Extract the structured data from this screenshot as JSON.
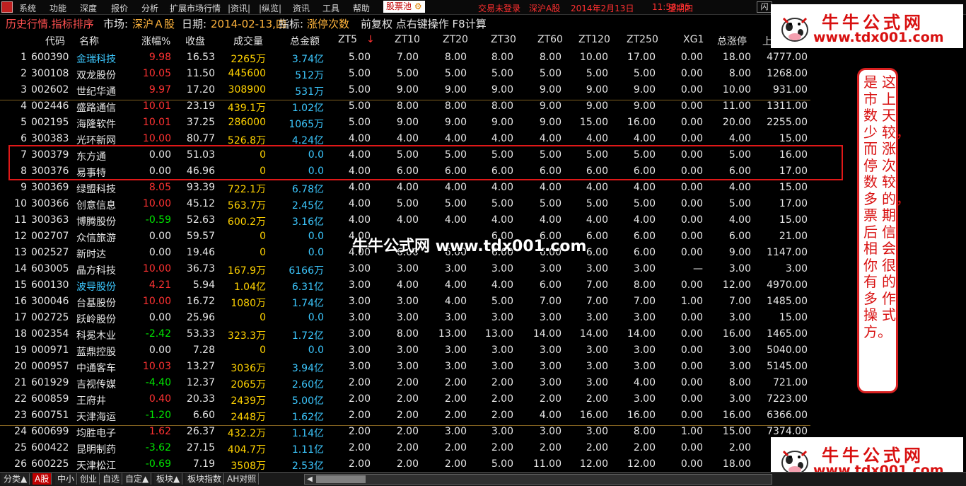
{
  "menu": {
    "items": [
      "系统",
      "功能",
      "深度",
      "报价",
      "分析",
      "扩展市场行情",
      "|资讯|",
      "|纵览|",
      "资讯",
      "工具",
      "帮助"
    ],
    "pool_label": "股票池",
    "status": [
      "交易未登录",
      "深沪A股",
      "2014年2月13日",
      "11:58:35",
      "星期四"
    ],
    "right_box": "闪"
  },
  "title": {
    "name": "历史行情.指标排序",
    "market_label": "市场:",
    "market": "深沪Ａ股",
    "date_label": "日期:",
    "date": "2014-02-13,四",
    "indicator_label": "指标:",
    "indicator": "涨停次数",
    "extra": "前复权 点右键操作 F8计算"
  },
  "columns": [
    "代码",
    "名称",
    "涨幅%",
    "收盘",
    "成交量",
    "总金额",
    "ZT5",
    "ZT10",
    "ZT20",
    "ZT30",
    "ZT60",
    "ZT120",
    "ZT250",
    "XG1",
    "总涨停",
    "上"
  ],
  "sort_arrow": "↓",
  "rows": [
    {
      "n": "1",
      "code": "600390",
      "name": "金瑞科技",
      "chg": "9.98",
      "close": "16.53",
      "vol": "2265",
      "vunit": "万",
      "amt": "3.74",
      "aunit": "亿",
      "zt": [
        "5.00",
        "7.00",
        "8.00",
        "8.00",
        "8.00",
        "10.00",
        "17.00"
      ],
      "xg1": "0.00",
      "total": "18.00",
      "last": "4777.00",
      "chgc": "red",
      "namec": "cyan"
    },
    {
      "n": "2",
      "code": "300108",
      "name": "双龙股份",
      "chg": "10.05",
      "close": "11.50",
      "vol": "445600",
      "vunit": "",
      "amt": "512",
      "aunit": "万",
      "zt": [
        "5.00",
        "5.00",
        "5.00",
        "5.00",
        "5.00",
        "5.00",
        "5.00"
      ],
      "xg1": "0.00",
      "total": "8.00",
      "last": "1268.00",
      "chgc": "red",
      "namec": "white"
    },
    {
      "n": "3",
      "code": "002602",
      "name": "世纪华通",
      "chg": "9.97",
      "close": "17.20",
      "vol": "308900",
      "vunit": "",
      "amt": "531",
      "aunit": "万",
      "zt": [
        "5.00",
        "9.00",
        "9.00",
        "9.00",
        "9.00",
        "9.00",
        "9.00"
      ],
      "xg1": "0.00",
      "total": "10.00",
      "last": "931.00",
      "chgc": "red",
      "namec": "white"
    },
    {
      "n": "4",
      "code": "002446",
      "name": "盛路通信",
      "chg": "10.01",
      "close": "23.19",
      "vol": "439.1",
      "vunit": "万",
      "amt": "1.02",
      "aunit": "亿",
      "zt": [
        "5.00",
        "8.00",
        "8.00",
        "8.00",
        "9.00",
        "9.00",
        "9.00"
      ],
      "xg1": "0.00",
      "total": "11.00",
      "last": "1311.00",
      "chgc": "red",
      "namec": "white"
    },
    {
      "n": "5",
      "code": "002195",
      "name": "海隆软件",
      "chg": "10.01",
      "close": "37.25",
      "vol": "286000",
      "vunit": "",
      "amt": "1065",
      "aunit": "万",
      "zt": [
        "5.00",
        "9.00",
        "9.00",
        "9.00",
        "9.00",
        "15.00",
        "16.00"
      ],
      "xg1": "0.00",
      "total": "20.00",
      "last": "2255.00",
      "chgc": "red",
      "namec": "white"
    },
    {
      "n": "6",
      "code": "300383",
      "name": "光环新网",
      "chg": "10.00",
      "close": "80.77",
      "vol": "526.8",
      "vunit": "万",
      "amt": "4.24",
      "aunit": "亿",
      "zt": [
        "4.00",
        "4.00",
        "4.00",
        "4.00",
        "4.00",
        "4.00",
        "4.00"
      ],
      "xg1": "0.00",
      "total": "4.00",
      "last": "15.00",
      "chgc": "red",
      "namec": "white"
    },
    {
      "n": "7",
      "code": "300379",
      "name": "东方通",
      "chg": "0.00",
      "close": "51.03",
      "vol": "0",
      "vunit": "",
      "amt": "0.0",
      "aunit": "",
      "zt": [
        "4.00",
        "5.00",
        "5.00",
        "5.00",
        "5.00",
        "5.00",
        "5.00"
      ],
      "xg1": "0.00",
      "total": "5.00",
      "last": "16.00",
      "chgc": "white",
      "namec": "white"
    },
    {
      "n": "8",
      "code": "300376",
      "name": "易事特",
      "chg": "0.00",
      "close": "46.96",
      "vol": "0",
      "vunit": "",
      "amt": "0.0",
      "aunit": "",
      "zt": [
        "4.00",
        "6.00",
        "6.00",
        "6.00",
        "6.00",
        "6.00",
        "6.00"
      ],
      "xg1": "0.00",
      "total": "6.00",
      "last": "17.00",
      "chgc": "white",
      "namec": "white"
    },
    {
      "n": "9",
      "code": "300369",
      "name": "绿盟科技",
      "chg": "8.05",
      "close": "93.39",
      "vol": "722.1",
      "vunit": "万",
      "amt": "6.78",
      "aunit": "亿",
      "zt": [
        "4.00",
        "4.00",
        "4.00",
        "4.00",
        "4.00",
        "4.00",
        "4.00"
      ],
      "xg1": "0.00",
      "total": "4.00",
      "last": "15.00",
      "chgc": "red",
      "namec": "white"
    },
    {
      "n": "10",
      "code": "300366",
      "name": "创意信息",
      "chg": "10.00",
      "close": "45.12",
      "vol": "563.7",
      "vunit": "万",
      "amt": "2.45",
      "aunit": "亿",
      "zt": [
        "4.00",
        "5.00",
        "5.00",
        "5.00",
        "5.00",
        "5.00",
        "5.00"
      ],
      "xg1": "0.00",
      "total": "5.00",
      "last": "17.00",
      "chgc": "red",
      "namec": "white"
    },
    {
      "n": "11",
      "code": "300363",
      "name": "博腾股份",
      "chg": "-0.59",
      "close": "52.63",
      "vol": "600.2",
      "vunit": "万",
      "amt": "3.16",
      "aunit": "亿",
      "zt": [
        "4.00",
        "4.00",
        "4.00",
        "4.00",
        "4.00",
        "4.00",
        "4.00"
      ],
      "xg1": "0.00",
      "total": "4.00",
      "last": "15.00",
      "chgc": "green",
      "namec": "white"
    },
    {
      "n": "12",
      "code": "002707",
      "name": "众信旅游",
      "chg": "0.00",
      "close": "59.57",
      "vol": "0",
      "vunit": "",
      "amt": "0.0",
      "aunit": "",
      "zt": [
        "4.00",
        "",
        "",
        "6.00",
        "6.00",
        "6.00",
        "6.00"
      ],
      "xg1": "0.00",
      "total": "6.00",
      "last": "21.00",
      "chgc": "white",
      "namec": "white"
    },
    {
      "n": "13",
      "code": "002527",
      "name": "新时达",
      "chg": "0.00",
      "close": "19.46",
      "vol": "0",
      "vunit": "",
      "amt": "0.0",
      "aunit": "",
      "zt": [
        "4.00",
        "6.00",
        "6.00",
        "6.00",
        "6.00",
        "6.00",
        "6.00"
      ],
      "xg1": "0.00",
      "total": "9.00",
      "last": "1147.00",
      "chgc": "white",
      "namec": "white"
    },
    {
      "n": "14",
      "code": "603005",
      "name": "晶方科技",
      "chg": "10.00",
      "close": "36.73",
      "vol": "167.9",
      "vunit": "万",
      "amt": "6166",
      "aunit": "万",
      "zt": [
        "3.00",
        "3.00",
        "3.00",
        "3.00",
        "3.00",
        "3.00",
        "3.00"
      ],
      "xg1": "—",
      "total": "3.00",
      "last": "3.00",
      "chgc": "red",
      "namec": "white"
    },
    {
      "n": "15",
      "code": "600130",
      "name": "波导股份",
      "chg": "4.21",
      "close": "5.94",
      "vol": "1.04",
      "vunit": "亿",
      "amt": "6.31",
      "aunit": "亿",
      "zt": [
        "3.00",
        "4.00",
        "4.00",
        "4.00",
        "6.00",
        "7.00",
        "8.00"
      ],
      "xg1": "0.00",
      "total": "12.00",
      "last": "4970.00",
      "chgc": "red",
      "namec": "cyan"
    },
    {
      "n": "16",
      "code": "300046",
      "name": "台基股份",
      "chg": "10.00",
      "close": "16.72",
      "vol": "1080",
      "vunit": "万",
      "amt": "1.74",
      "aunit": "亿",
      "zt": [
        "3.00",
        "3.00",
        "4.00",
        "5.00",
        "7.00",
        "7.00",
        "7.00"
      ],
      "xg1": "1.00",
      "total": "7.00",
      "last": "1485.00",
      "chgc": "red",
      "namec": "white"
    },
    {
      "n": "17",
      "code": "002725",
      "name": "跃岭股份",
      "chg": "0.00",
      "close": "25.96",
      "vol": "0",
      "vunit": "",
      "amt": "0.0",
      "aunit": "",
      "zt": [
        "3.00",
        "3.00",
        "3.00",
        "3.00",
        "3.00",
        "3.00",
        "3.00"
      ],
      "xg1": "0.00",
      "total": "3.00",
      "last": "15.00",
      "chgc": "white",
      "namec": "white"
    },
    {
      "n": "18",
      "code": "002354",
      "name": "科冕木业",
      "chg": "-2.42",
      "close": "53.33",
      "vol": "323.3",
      "vunit": "万",
      "amt": "1.72",
      "aunit": "亿",
      "zt": [
        "3.00",
        "8.00",
        "13.00",
        "13.00",
        "14.00",
        "14.00",
        "14.00"
      ],
      "xg1": "0.00",
      "total": "16.00",
      "last": "1465.00",
      "chgc": "green",
      "namec": "white"
    },
    {
      "n": "19",
      "code": "000971",
      "name": "蓝鼎控股",
      "chg": "0.00",
      "close": "7.28",
      "vol": "0",
      "vunit": "",
      "amt": "0.0",
      "aunit": "",
      "zt": [
        "3.00",
        "3.00",
        "3.00",
        "3.00",
        "3.00",
        "3.00",
        "3.00"
      ],
      "xg1": "0.00",
      "total": "3.00",
      "last": "5040.00",
      "chgc": "white",
      "namec": "white"
    },
    {
      "n": "20",
      "code": "000957",
      "name": "中通客车",
      "chg": "10.03",
      "close": "13.27",
      "vol": "3036",
      "vunit": "万",
      "amt": "3.94",
      "aunit": "亿",
      "zt": [
        "3.00",
        "3.00",
        "3.00",
        "3.00",
        "3.00",
        "3.00",
        "3.00"
      ],
      "xg1": "0.00",
      "total": "3.00",
      "last": "5145.00",
      "chgc": "red",
      "namec": "white"
    },
    {
      "n": "21",
      "code": "601929",
      "name": "吉视传媒",
      "chg": "-4.40",
      "close": "12.37",
      "vol": "2065",
      "vunit": "万",
      "amt": "2.60",
      "aunit": "亿",
      "zt": [
        "2.00",
        "2.00",
        "2.00",
        "2.00",
        "3.00",
        "3.00",
        "4.00"
      ],
      "xg1": "0.00",
      "total": "8.00",
      "last": "721.00",
      "chgc": "green",
      "namec": "white"
    },
    {
      "n": "22",
      "code": "600859",
      "name": "王府井",
      "chg": "0.40",
      "close": "20.33",
      "vol": "2439",
      "vunit": "万",
      "amt": "5.00",
      "aunit": "亿",
      "zt": [
        "2.00",
        "2.00",
        "2.00",
        "2.00",
        "2.00",
        "2.00",
        "3.00"
      ],
      "xg1": "0.00",
      "total": "3.00",
      "last": "7223.00",
      "chgc": "red",
      "namec": "white"
    },
    {
      "n": "23",
      "code": "600751",
      "name": "天津海运",
      "chg": "-1.20",
      "close": "6.60",
      "vol": "2448",
      "vunit": "万",
      "amt": "1.62",
      "aunit": "亿",
      "zt": [
        "2.00",
        "2.00",
        "2.00",
        "2.00",
        "4.00",
        "16.00",
        "16.00"
      ],
      "xg1": "0.00",
      "total": "16.00",
      "last": "6366.00",
      "chgc": "green",
      "namec": "white"
    },
    {
      "n": "24",
      "code": "600699",
      "name": "均胜电子",
      "chg": "1.62",
      "close": "26.37",
      "vol": "432.2",
      "vunit": "万",
      "amt": "1.14",
      "aunit": "亿",
      "zt": [
        "2.00",
        "2.00",
        "3.00",
        "3.00",
        "3.00",
        "3.00",
        "8.00"
      ],
      "xg1": "1.00",
      "total": "15.00",
      "last": "7374.00",
      "chgc": "red",
      "namec": "white"
    },
    {
      "n": "25",
      "code": "600422",
      "name": "昆明制药",
      "chg": "-3.62",
      "close": "27.15",
      "vol": "404.7",
      "vunit": "万",
      "amt": "1.11",
      "aunit": "亿",
      "zt": [
        "2.00",
        "2.00",
        "2.00",
        "2.00",
        "2.00",
        "2.00",
        "2.00"
      ],
      "xg1": "0.00",
      "total": "2.00",
      "last": "",
      "chgc": "green",
      "namec": "white"
    },
    {
      "n": "26",
      "code": "600225",
      "name": "天津松江",
      "chg": "-0.69",
      "close": "7.19",
      "vol": "3508",
      "vunit": "万",
      "amt": "2.53",
      "aunit": "亿",
      "zt": [
        "2.00",
        "2.00",
        "2.00",
        "5.00",
        "11.00",
        "12.00",
        "12.00"
      ],
      "xg1": "0.00",
      "total": "18.00",
      "last": "",
      "chgc": "green",
      "namec": "white"
    }
  ],
  "note_text": "这是上市天数较少，而涨停次数较多的票，后期相信你会有很多的操作方式。",
  "watermark": "牛牛公式网 www.tdx001.com",
  "ad": {
    "title": "牛牛公式网",
    "url": "www.tdx001.com"
  },
  "bottom_tabs": [
    "分类▲",
    "A股",
    "中小",
    "创业",
    "自选",
    "自定▲",
    "板块▲",
    "板块指数",
    "AH对照"
  ],
  "colors": {
    "red": "#ff3232",
    "green": "#00e600",
    "cyan": "#3cc8ff",
    "yellow": "#ffd200",
    "white": "#e6e6e6",
    "accent": "#ffb43c"
  }
}
